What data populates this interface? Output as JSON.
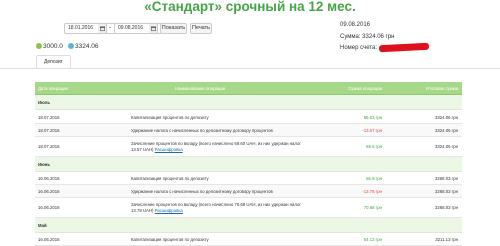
{
  "title": "«Стандарт» срочный на 12 мес.",
  "filter": {
    "date_from": "18.01.2016",
    "date_to": "09.08.2016",
    "show_label": "Показать",
    "print_label": "Печать"
  },
  "info": {
    "date": "09.08.2016",
    "sum": "Сумма: 3324.06 грн",
    "account_label": "Номер счета:"
  },
  "balances": {
    "initial": "3000.0",
    "current": "3324.06"
  },
  "tabs": [
    {
      "label": "Депозит"
    }
  ],
  "table": {
    "headers": {
      "date": "Дата операции",
      "name": "Наименование операции",
      "amount": "Сумма операции",
      "total": "Итоговая сумма"
    },
    "groups": [
      {
        "label": "Июль",
        "rows": [
          {
            "date": "18.07.2016",
            "name": "Капитализация процентов по депозиту",
            "name2": "",
            "link": "",
            "amount": "56.03 грн",
            "total": "3324.06 грн"
          },
          {
            "date": "18.07.2016",
            "name": "Удержание налога с начисленных по депозитному договору процентов",
            "name2": "",
            "link": "",
            "amount": "-13.57 грн",
            "total": "3324.06 грн"
          },
          {
            "date": "18.07.2016",
            "name": "Зачисление процентов по вкладу (всего начислено 69.60 UAH, из них удержан налог",
            "name2": "13.57 UAH)",
            "link": "Расшифровка",
            "amount": "69.6 грн",
            "total": "3324.06 грн"
          }
        ]
      },
      {
        "label": "Июнь",
        "rows": [
          {
            "date": "16.06.2016",
            "name": "Капитализация процентов по депозиту",
            "name2": "",
            "link": "",
            "amount": "56.9 грн",
            "total": "3268.03 грн"
          },
          {
            "date": "16.06.2016",
            "name": "Удержание налога с начисленных по депозитному договору процентов",
            "name2": "",
            "link": "",
            "amount": "-13.78 грн",
            "total": "3268.03 грн"
          },
          {
            "date": "16.06.2016",
            "name": "Зачисление процентов по вкладу (всего начислено 70.68 UAH, из них удержан налог",
            "name2": "13.78 UAH)",
            "link": "Расшифровка",
            "amount": "70.68 грн",
            "total": "3268.03 грн"
          }
        ]
      },
      {
        "label": "Май",
        "rows": [
          {
            "date": "16.05.2016",
            "name": "Капитализация процентов по депозиту",
            "name2": "",
            "link": "",
            "amount": "54.13 грн",
            "total": "3211.13 грн"
          }
        ]
      }
    ]
  },
  "colors": {
    "accent": "#47a447",
    "header_bg": "#a7d889",
    "group_bg": "#ecf7e5",
    "redaction": "#e0101d"
  }
}
